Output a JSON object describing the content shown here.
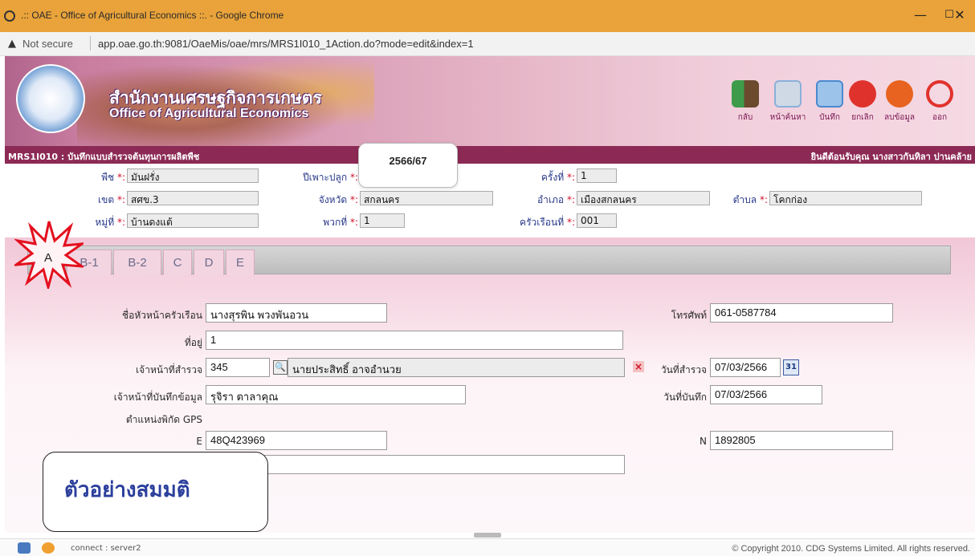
{
  "window": {
    "title": ".:: OAE - Office of Agricultural Economics ::. - Google Chrome",
    "minimize": "—",
    "maximize": "☐",
    "close": "✕"
  },
  "address": {
    "security": "Not secure",
    "url": "app.oae.go.th:9081/OaeMis/oae/mrs/MRS1I010_1Action.do?mode=edit&index=1"
  },
  "banner": {
    "org_th": "สำนักงานเศรษฐกิจการเกษตร",
    "org_en": "Office of Agricultural Economics",
    "tools": [
      {
        "label": "กลับ",
        "icon": "back-door-icon",
        "color": "#3d9b4a"
      },
      {
        "label": "หน้าค้นหา",
        "icon": "search-page-icon",
        "color": "#8ab0d9"
      },
      {
        "label": "บันทึก",
        "icon": "save-icon",
        "color": "#4a8ad0"
      },
      {
        "label": "ยกเลิก",
        "icon": "cancel-icon",
        "color": "#e0322c"
      },
      {
        "label": "ลบข้อมูล",
        "icon": "delete-icon",
        "color": "#e8631f"
      },
      {
        "label": "ออก",
        "icon": "power-icon",
        "color": "#e0322c"
      }
    ]
  },
  "progbar": {
    "program": "MRS1I010 : บันทึกแบบสำรวจต้นทุนการผลิตพืช",
    "welcome": "ยินดีต้อนรับคุณ นางสาวกันทิลา ปานคล้าย"
  },
  "info": {
    "crop": {
      "label": "พืช",
      "value": "มันฝรั่ง"
    },
    "season": {
      "label": "ปีเพาะปลูก",
      "value": "2566/67"
    },
    "round": {
      "label": "ครั้งที่",
      "value": "1"
    },
    "zone": {
      "label": "เขต",
      "value": "สศข.3"
    },
    "province": {
      "label": "จังหวัด",
      "value": "สกลนคร"
    },
    "district": {
      "label": "อำเภอ",
      "value": "เมืองสกลนคร"
    },
    "subdistrict": {
      "label": "ตำบล",
      "value": "โคกก่อง"
    },
    "village": {
      "label": "หมู่ที่",
      "value": "บ้านดงแต้"
    },
    "group": {
      "label": "พวกที่",
      "value": "1"
    },
    "household_no": {
      "label": "ครัวเรือนที่",
      "value": "001"
    },
    "req_mark": "*:"
  },
  "tabs": [
    "A",
    "B-1",
    "B-2",
    "C",
    "D",
    "E"
  ],
  "form": {
    "head_label": "ชื่อหัวหน้าครัวเรือน",
    "head_value": "นางสุรพิน พวงพันอวน",
    "phone_label": "โทรศัพท์",
    "phone_value": "061-0587784",
    "address_label": "ที่อยู่",
    "address_value": "1",
    "surveyor_label": "เจ้าหน้าที่สำรวจ",
    "surveyor_code": "345",
    "surveyor_name": "นายประสิทธิ์  อาจอำนวย",
    "survey_date_label": "วันที่สำรวจ",
    "survey_date_value": "07/03/2566",
    "calendar_text": "31",
    "recorder_label": "เจ้าหน้าที่บันทึกข้อมูล",
    "recorder_value": "รุจิรา ตาลาคุณ",
    "record_date_label": "วันที่บันทึก",
    "record_date_value": "07/03/2566",
    "gps_label": "ตำแหน่งพิกัด GPS",
    "e_label": "E",
    "e_value": "48Q423969",
    "n_label": "N",
    "n_value": "1892805",
    "extra_value": ""
  },
  "callout": "ตัวอย่างสมมติ",
  "status": {
    "connection": "connect : server2",
    "copyright": "© Copyright 2010. CDG Systems Limited. All rights reserved."
  }
}
